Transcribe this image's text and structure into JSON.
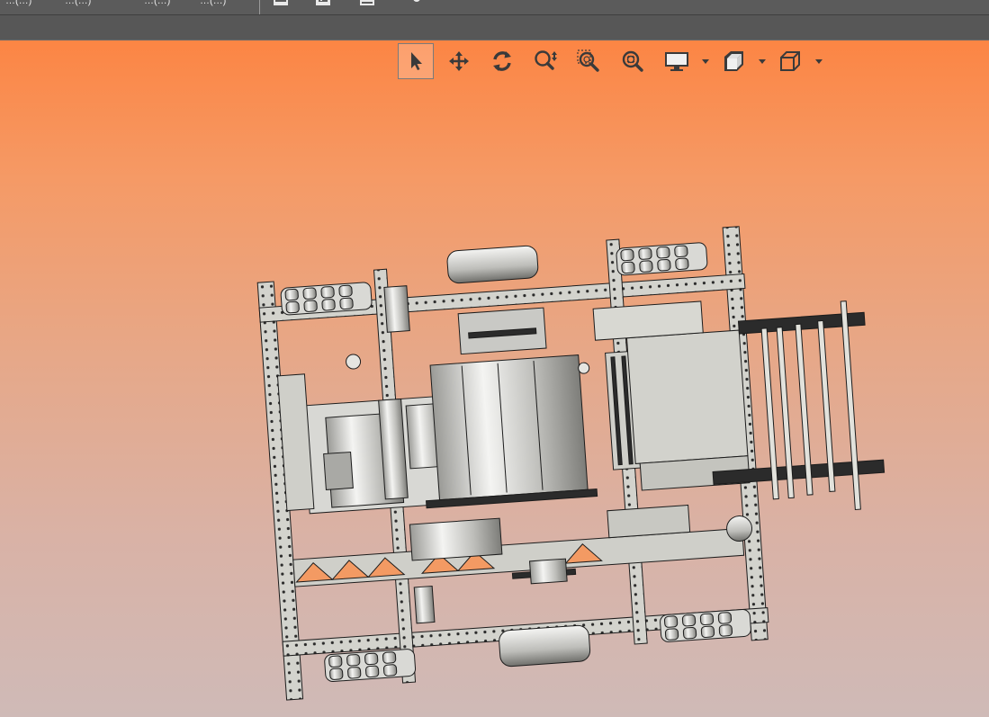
{
  "app": {
    "menu": [
      {
        "id": "file",
        "label": "…(…)"
      },
      {
        "id": "edit",
        "label": "…(…)"
      },
      {
        "id": "view",
        "label": "…(…)"
      },
      {
        "id": "help",
        "label": "…(…)"
      }
    ]
  },
  "toolbar": {
    "tools": [
      {
        "id": "select",
        "icon": "cursor-arrow-icon",
        "active": true
      },
      {
        "id": "pan",
        "icon": "move-arrows-icon",
        "active": false
      },
      {
        "id": "rotate",
        "icon": "rotate-icon",
        "active": false
      },
      {
        "id": "zoom",
        "icon": "zoom-in-out-icon",
        "active": false
      },
      {
        "id": "zoom-window",
        "icon": "zoom-window-icon",
        "active": false
      },
      {
        "id": "zoom-fit",
        "icon": "zoom-fit-icon",
        "active": false
      },
      {
        "id": "display-mode",
        "icon": "monitor-icon",
        "has_dropdown": true
      },
      {
        "id": "section-view",
        "icon": "section-cube-icon",
        "has_dropdown": true
      },
      {
        "id": "standard-views",
        "icon": "cube-outline-icon",
        "has_dropdown": true
      }
    ]
  },
  "colors": {
    "gradient_top": "#fe7f3a",
    "gradient_bottom": "#cfbab7",
    "toolbar_icon": "#3a3a3a",
    "metal": "#cfcfc9",
    "line": "#1c1c1c"
  }
}
